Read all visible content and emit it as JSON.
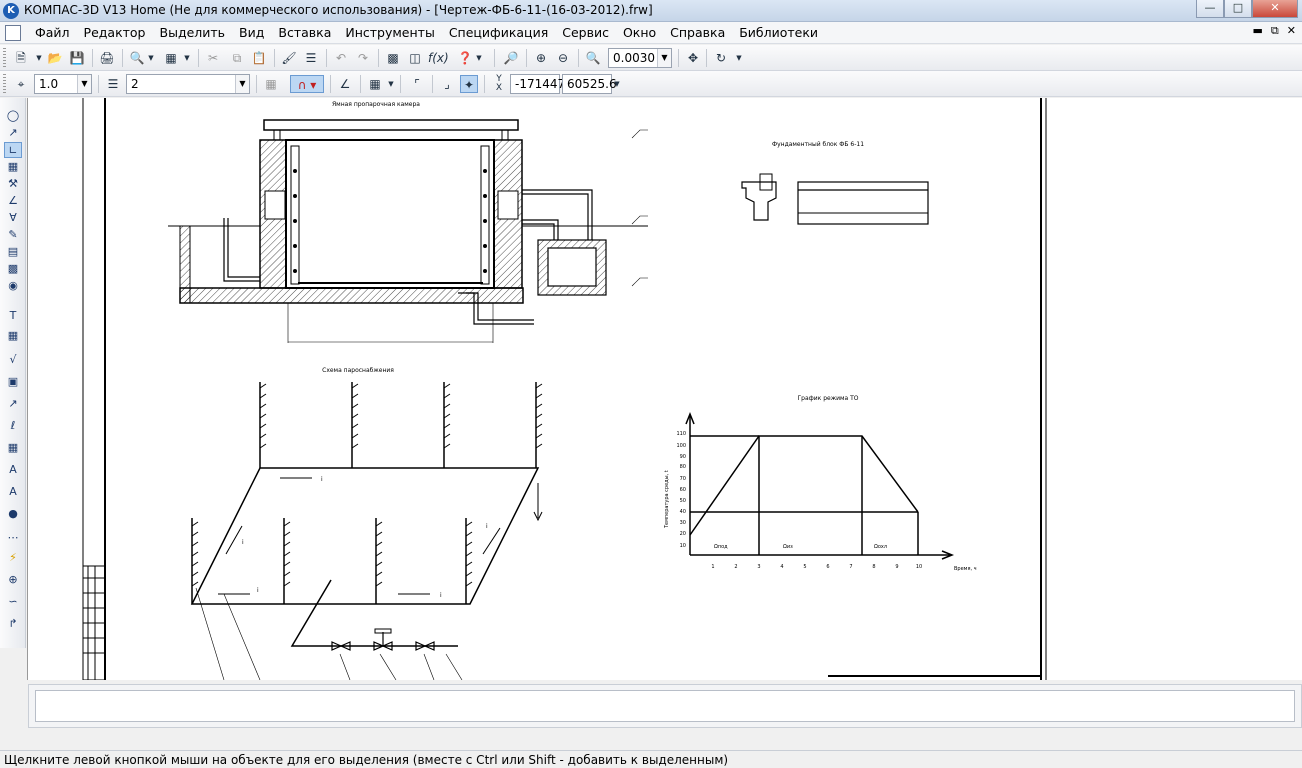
{
  "window": {
    "title": "КОМПАС-3D V13 Home (Не для коммерческого использования) - [Чертеж-ФБ-6-11-(16-03-2012).frw]",
    "app_icon": "K"
  },
  "menu": {
    "items": [
      "Файл",
      "Редактор",
      "Выделить",
      "Вид",
      "Вставка",
      "Инструменты",
      "Спецификация",
      "Сервис",
      "Окно",
      "Справка",
      "Библиотеки"
    ]
  },
  "toolbar1": {
    "zoom_value": "0.0030"
  },
  "toolbar2": {
    "line_scale": "1.0",
    "layer": "2",
    "coord_x": "-171447",
    "coord_y": "60525.6",
    "xy_label": "Y",
    "xy_label2": "X"
  },
  "drawing": {
    "section_title": "Ямная пропарочная камера",
    "block_title": "Фундаментный блок ФБ 6-11",
    "scheme_title": "Схема пароснабжения",
    "graph_title": "График режима ТО",
    "graph": {
      "y_axis_label": "Температура среды, t",
      "x_axis_label": "Время, ч",
      "y_ticks": [
        "10",
        "20",
        "30",
        "40",
        "50",
        "60",
        "70",
        "80",
        "90",
        "100",
        "110"
      ],
      "x_ticks": [
        "1",
        "2",
        "3",
        "4",
        "5",
        "6",
        "7",
        "8",
        "9",
        "10"
      ],
      "phase_labels": [
        "Ωпод",
        "Ωиз",
        "Ωохл"
      ]
    },
    "flow_marks": [
      "i",
      "i",
      "i",
      "i",
      "i",
      "i"
    ]
  },
  "status": {
    "message": "Щелкните левой кнопкой мыши на объекте для его выделения (вместе с Ctrl или Shift - добавить к выделенным)"
  },
  "colors": {
    "titlebar": "#c6d5e8",
    "close_button": "#c9483a",
    "active_tool": "#bcd7f3"
  }
}
